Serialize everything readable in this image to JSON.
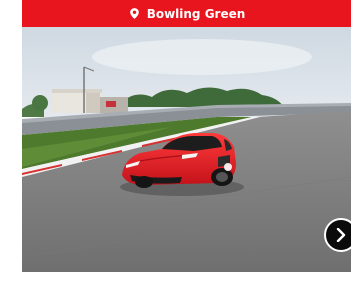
{
  "card": {
    "location_label": "Bowling Green",
    "pin_icon": "location-pin-icon",
    "next_icon": "chevron-right-icon"
  },
  "colors": {
    "banner": "#e8141e",
    "car": "#e21b23",
    "button": "#0b0b0b"
  }
}
